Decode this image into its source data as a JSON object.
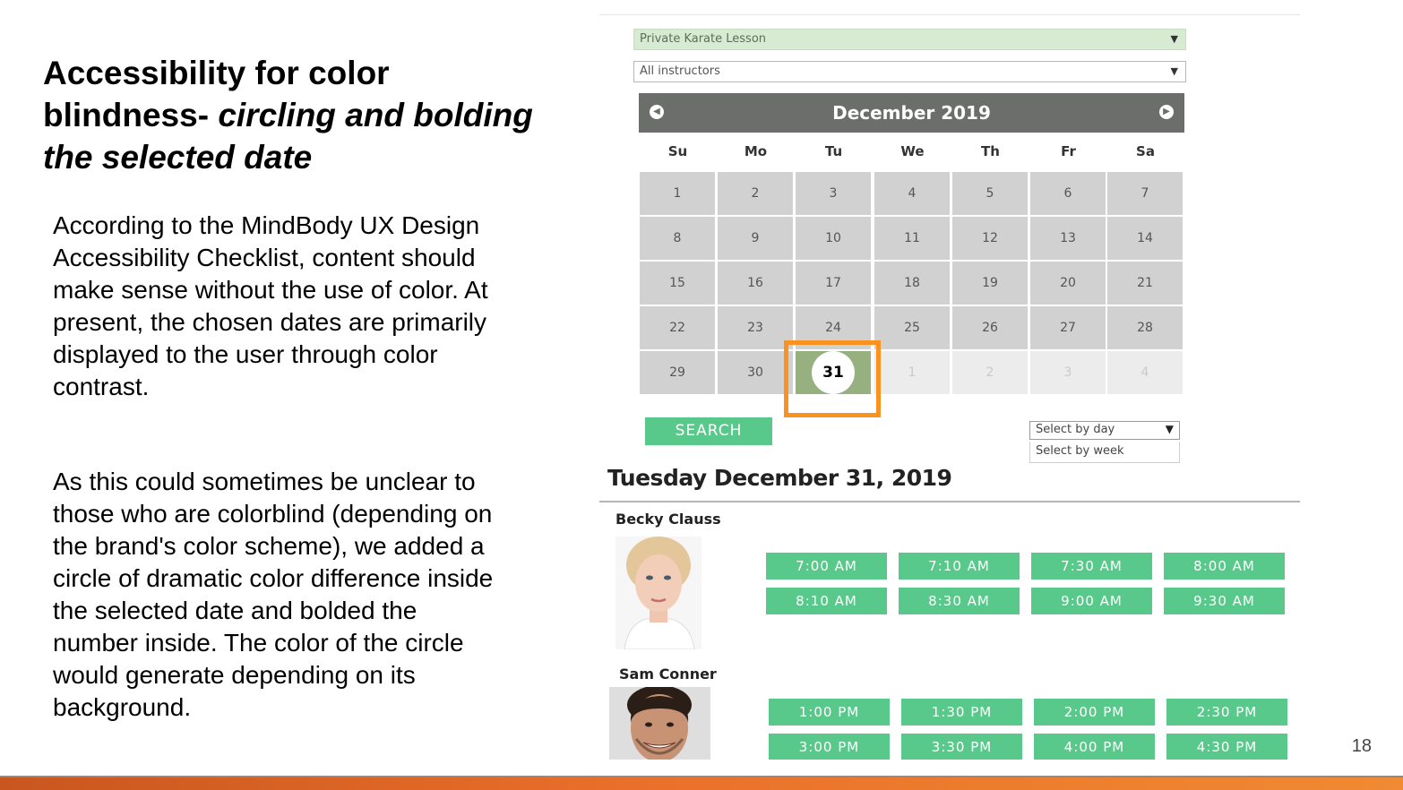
{
  "slide": {
    "title_plain": "Accessibility for color blindness- ",
    "title_italic": "circling and bolding the selected date",
    "paragraph1": "According to the MindBody UX Design Accessibility Checklist, content should make sense without the use of color.  At present, the chosen dates are primarily displayed to the user through color contrast.",
    "paragraph2": "As this could sometimes be unclear to those who are colorblind (depending on the brand's color scheme), we added a circle of dramatic color difference inside the selected date and bolded the number inside.  The color of the circle would generate depending on its background.",
    "page_number": "18"
  },
  "booking": {
    "service_select": "Private Karate Lesson",
    "instructor_select": "All instructors",
    "calendar": {
      "month_label": "December 2019",
      "weekdays": [
        "Su",
        "Mo",
        "Tu",
        "We",
        "Th",
        "Fr",
        "Sa"
      ],
      "weeks": [
        [
          "1",
          "2",
          "3",
          "4",
          "5",
          "6",
          "7"
        ],
        [
          "8",
          "9",
          "10",
          "11",
          "12",
          "13",
          "14"
        ],
        [
          "15",
          "16",
          "17",
          "18",
          "19",
          "20",
          "21"
        ],
        [
          "22",
          "23",
          "24",
          "25",
          "26",
          "27",
          "28"
        ],
        [
          "29",
          "30",
          "31",
          "1",
          "2",
          "3",
          "4"
        ]
      ],
      "selected_day": "31"
    },
    "search_label": "SEARCH",
    "view_select": "Select by day",
    "view_option": "Select by week",
    "date_heading": "Tuesday December 31, 2019",
    "instructors": [
      {
        "name": "Becky Clauss",
        "slots": [
          "7:00 AM",
          "7:10 AM",
          "7:30 AM",
          "8:00 AM",
          "8:10 AM",
          "8:30 AM",
          "9:00 AM",
          "9:30 AM"
        ]
      },
      {
        "name": "Sam Conner",
        "slots": [
          "1:00 PM",
          "1:30 PM",
          "2:00 PM",
          "2:30 PM",
          "3:00 PM",
          "3:30 PM",
          "4:00 PM",
          "4:30 PM"
        ]
      }
    ]
  },
  "colors": {
    "accent_green": "#59c98b",
    "selected_cell": "#97b07f",
    "highlight_orange": "#f7931e",
    "calendar_header": "#6c6e6b"
  }
}
